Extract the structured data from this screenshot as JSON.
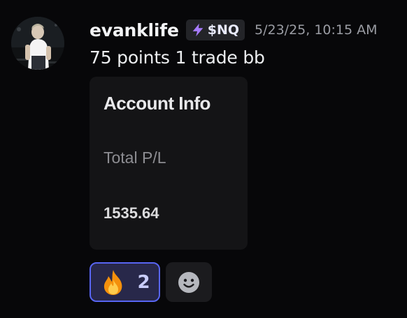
{
  "message": {
    "author": "evanklife",
    "tag": {
      "icon": "lightning-icon",
      "text": "$NQ"
    },
    "timestamp": "5/23/25, 10:15 AM",
    "content": "75 points 1 trade bb",
    "embed": {
      "title": "Account Info",
      "label": "Total P/L",
      "value": "1535.64"
    },
    "reactions": [
      {
        "emoji": "fire-icon",
        "count": "2",
        "selected": true
      }
    ],
    "add_reaction_icon": "smiley-icon"
  },
  "colors": {
    "background": "#070709",
    "accent": "#5865f2",
    "tag_icon": "#a77bff"
  }
}
